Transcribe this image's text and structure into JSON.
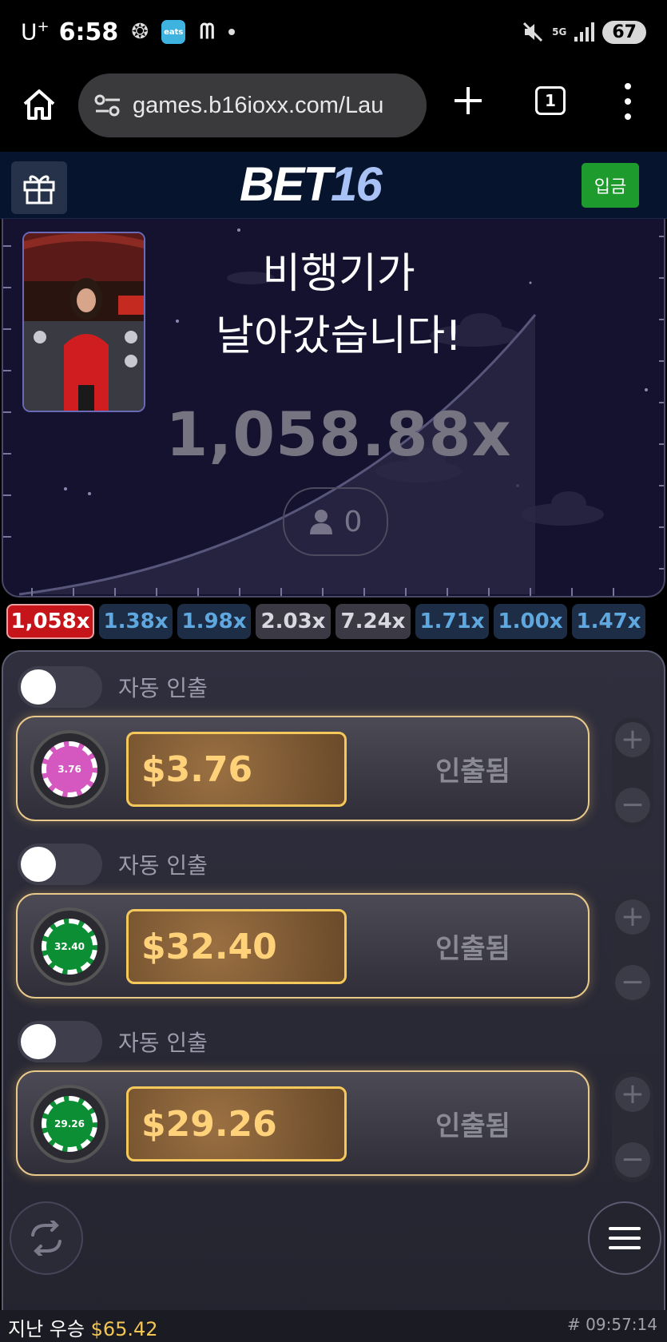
{
  "status_bar": {
    "carrier": "U",
    "carrier_plus": "+",
    "time": "6:58",
    "app_eats": "eats",
    "battery": "67",
    "network": "5G"
  },
  "browser": {
    "url": "games.b16ioxx.com/Lau",
    "tab_count": "1"
  },
  "site": {
    "brand_part1": "BET",
    "brand_part2": "16",
    "deposit_label": "입금"
  },
  "game": {
    "flew_away_line1": "비행기가",
    "flew_away_line2": "날아갔습니다!",
    "multiplier": "1,058.88x",
    "player_count": "0"
  },
  "history": [
    {
      "value": "1,058x",
      "style": "red"
    },
    {
      "value": "1.38x",
      "style": "blue"
    },
    {
      "value": "1.98x",
      "style": "blue"
    },
    {
      "value": "2.03x",
      "style": "grey"
    },
    {
      "value": "7.24x",
      "style": "grey"
    },
    {
      "value": "1.71x",
      "style": "blue"
    },
    {
      "value": "1.00x",
      "style": "blue"
    },
    {
      "value": "1.47x",
      "style": "blue"
    }
  ],
  "bets": [
    {
      "auto_label": "자동 인출",
      "chip_value": "3.76",
      "chip_color": "#d558c0",
      "amount": "$3.76",
      "status": "인출됨"
    },
    {
      "auto_label": "자동 인출",
      "chip_value": "32.40",
      "chip_color": "#0c8f34",
      "amount": "$32.40",
      "status": "인출됨"
    },
    {
      "auto_label": "자동 인출",
      "chip_value": "29.26",
      "chip_color": "#0c8f34",
      "amount": "$29.26",
      "status": "인출됨"
    }
  ],
  "steppers": {
    "plus": "+",
    "minus": "−"
  },
  "footer": {
    "last_win_label": "지난 우승",
    "last_win_amount": "$65.42",
    "round_time": "# 09:57:14"
  },
  "colors": {
    "accent_gold": "#f4c85a",
    "deposit_green": "#1e9b2d",
    "history_red": "#c5151b",
    "history_blue_text": "#5fa8df"
  },
  "icons": [
    "home-icon",
    "site-settings-icon",
    "plus-icon",
    "tabs-icon",
    "more-vert-icon",
    "gift-icon",
    "user-icon",
    "refresh-icon",
    "hamburger-icon",
    "mute-icon",
    "signal-icon"
  ]
}
